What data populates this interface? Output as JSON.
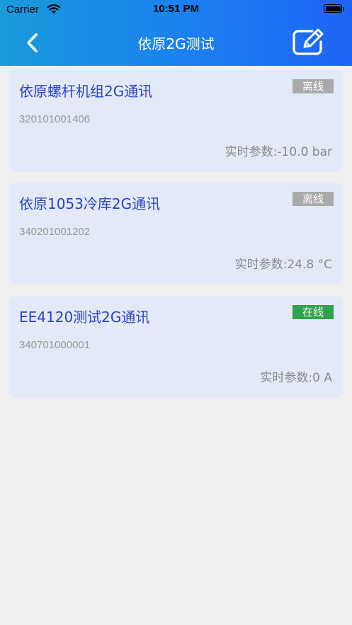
{
  "status_bar": {
    "carrier": "Carrier",
    "time": "10:51 PM"
  },
  "nav": {
    "title": "依原2G测试",
    "back_icon": "chevron-left-icon",
    "edit_icon": "edit-icon"
  },
  "devices": [
    {
      "name": "依原螺杆机组2G通讯",
      "status": "离线",
      "status_color": "#aaaaaa",
      "id": "320101001406",
      "param": "实时参数:-10.0 bar"
    },
    {
      "name": "依原1053冷库2G通讯",
      "status": "离线",
      "status_color": "#aaaaaa",
      "id": "340201001202",
      "param": "实时参数:24.8 °C"
    },
    {
      "name": "EE4120测试2G通讯",
      "status": "在线",
      "status_color": "#31a24c",
      "id": "340701000001",
      "param": "实时参数:0 A"
    }
  ],
  "colors": {
    "header_start": "#1a9bdc",
    "header_end": "#1e63f5",
    "card_background": "#e3e9f7",
    "title_text": "#2b43c8",
    "page_background": "#efefef"
  }
}
